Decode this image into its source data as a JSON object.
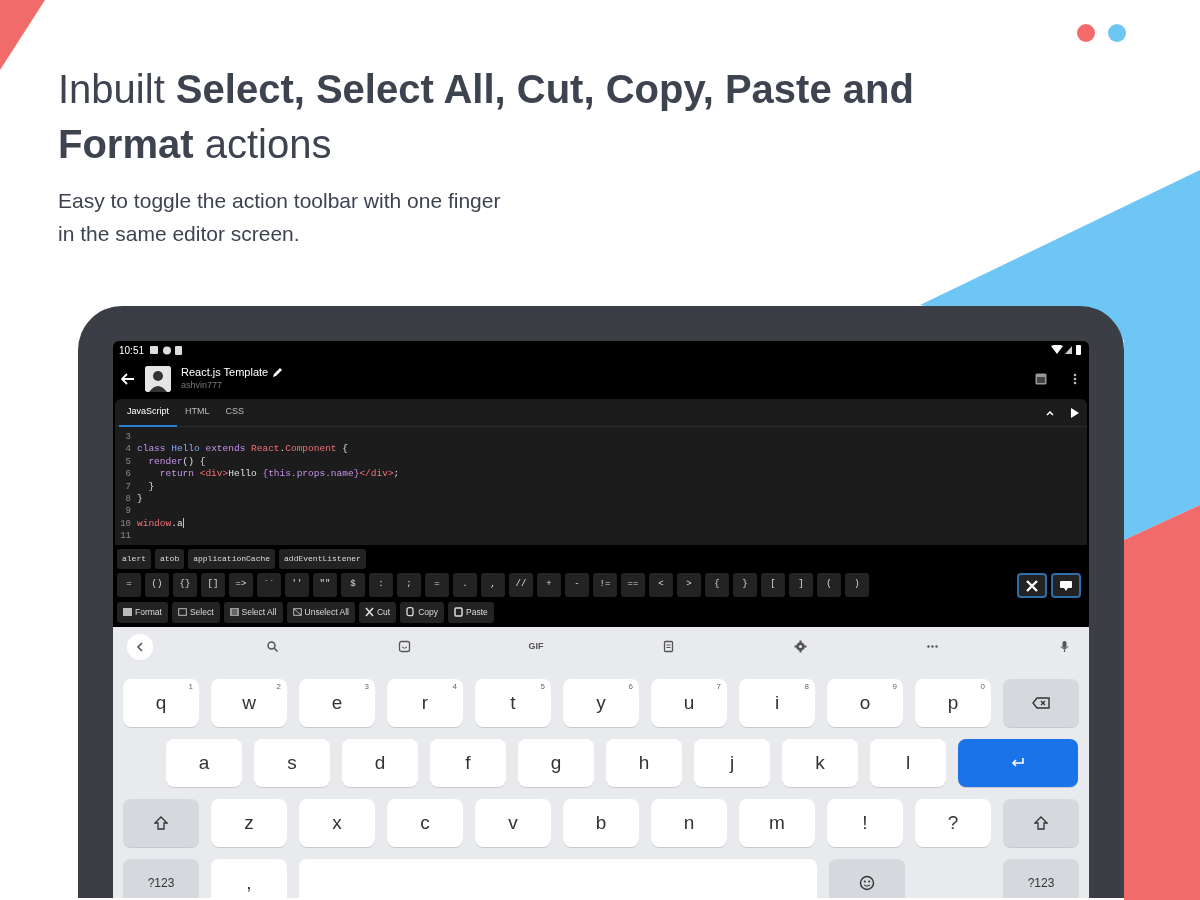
{
  "headline": "Inbuilt **Select, Select All, Cut, Copy, Paste and Format** actions",
  "subtitle": "Easy to toggle the action toolbar with one finger in the same editor screen.",
  "status_bar": {
    "time": "10:51"
  },
  "app_bar": {
    "title": "React.js Template",
    "subtitle": "ashvin777"
  },
  "tabs": [
    {
      "label": "JavaScript",
      "selected": true
    },
    {
      "label": "HTML",
      "selected": false
    },
    {
      "label": "CSS",
      "selected": false
    }
  ],
  "code_lines": [
    {
      "number": "3"
    },
    {
      "number": "4",
      "tokens": [
        {
          "text": "class ",
          "kind": "keyword"
        },
        {
          "text": "Hello ",
          "kind": "name"
        },
        {
          "text": "extends ",
          "kind": "keyword"
        },
        {
          "text": "React",
          "kind": "object"
        },
        {
          "text": ".",
          "kind": "plain"
        },
        {
          "text": "Component ",
          "kind": "object"
        },
        {
          "text": "{",
          "kind": "plain"
        }
      ]
    },
    {
      "number": "5",
      "tokens": [
        {
          "text": "  render",
          "kind": "keyword"
        },
        {
          "text": "() {",
          "kind": "plain"
        }
      ]
    },
    {
      "number": "6",
      "tokens": [
        {
          "text": "    return ",
          "kind": "keyword"
        },
        {
          "text": "<div>",
          "kind": "object"
        },
        {
          "text": "Hello ",
          "kind": "plain"
        },
        {
          "text": "{this.props.name}",
          "kind": "keyword"
        },
        {
          "text": "</div>",
          "kind": "object"
        },
        {
          "text": ";",
          "kind": "plain"
        }
      ]
    },
    {
      "number": "7",
      "tokens": [
        {
          "text": "  }",
          "kind": "plain"
        }
      ]
    },
    {
      "number": "8",
      "tokens": [
        {
          "text": "}",
          "kind": "plain"
        }
      ]
    },
    {
      "number": "9"
    },
    {
      "number": "10",
      "tokens": [
        {
          "text": "window",
          "kind": "object"
        },
        {
          "text": ".a",
          "kind": "plain"
        }
      ],
      "cursor": true
    },
    {
      "number": "11"
    }
  ],
  "suggestions": [
    "alert",
    "atob",
    "applicationCache",
    "addEventListener"
  ],
  "symbols": [
    "=",
    "()",
    "{}",
    "[]",
    "=>",
    "``",
    "''",
    "\"\"",
    "$",
    ":",
    ";",
    "=",
    ".",
    ",",
    "//",
    "+",
    "-",
    "!=",
    "==",
    "<",
    ">",
    "{",
    "}",
    "[",
    "]",
    "(",
    ")"
  ],
  "actions": [
    {
      "label": "Format",
      "kind": "format"
    },
    {
      "label": "Select",
      "kind": "select"
    },
    {
      "label": "Select All",
      "kind": "select_all"
    },
    {
      "label": "Unselect All",
      "kind": "unselect_all"
    },
    {
      "label": "Cut",
      "kind": "cut"
    },
    {
      "label": "Copy",
      "kind": "copy"
    },
    {
      "label": "Paste",
      "kind": "paste"
    }
  ],
  "toggles": [
    {
      "kind": "tools",
      "on": true
    },
    {
      "kind": "keyboard",
      "on": true
    }
  ],
  "keyboard_toolbar": [
    {
      "kind": "back"
    },
    {
      "kind": "search"
    },
    {
      "kind": "sticker"
    },
    {
      "kind": "gif",
      "label": "GIF"
    },
    {
      "kind": "clipboard"
    },
    {
      "kind": "settings"
    },
    {
      "kind": "more"
    },
    {
      "kind": "mic"
    }
  ],
  "keyboard_rows": [
    [
      {
        "kind": "letter",
        "label": "q",
        "hint": "1"
      },
      {
        "kind": "letter",
        "label": "w",
        "hint": "2"
      },
      {
        "kind": "letter",
        "label": "e",
        "hint": "3"
      },
      {
        "kind": "letter",
        "label": "r",
        "hint": "4"
      },
      {
        "kind": "letter",
        "label": "t",
        "hint": "5"
      },
      {
        "kind": "letter",
        "label": "y",
        "hint": "6"
      },
      {
        "kind": "letter",
        "label": "u",
        "hint": "7"
      },
      {
        "kind": "letter",
        "label": "i",
        "hint": "8"
      },
      {
        "kind": "letter",
        "label": "o",
        "hint": "9"
      },
      {
        "kind": "letter",
        "label": "p",
        "hint": "0"
      },
      {
        "kind": "backspace"
      }
    ],
    [
      {
        "kind": "letter",
        "label": "a"
      },
      {
        "kind": "letter",
        "label": "s"
      },
      {
        "kind": "letter",
        "label": "d"
      },
      {
        "kind": "letter",
        "label": "f"
      },
      {
        "kind": "letter",
        "label": "g"
      },
      {
        "kind": "letter",
        "label": "h"
      },
      {
        "kind": "letter",
        "label": "j"
      },
      {
        "kind": "letter",
        "label": "k"
      },
      {
        "kind": "letter",
        "label": "l"
      },
      {
        "kind": "enter"
      }
    ],
    [
      {
        "kind": "shift"
      },
      {
        "kind": "letter",
        "label": "z"
      },
      {
        "kind": "letter",
        "label": "x"
      },
      {
        "kind": "letter",
        "label": "c"
      },
      {
        "kind": "letter",
        "label": "v"
      },
      {
        "kind": "letter",
        "label": "b"
      },
      {
        "kind": "letter",
        "label": "n"
      },
      {
        "kind": "letter",
        "label": "m"
      },
      {
        "kind": "letter",
        "label": "!"
      },
      {
        "kind": "letter",
        "label": "?"
      },
      {
        "kind": "shift"
      }
    ],
    [
      {
        "kind": "mode",
        "label": "?123"
      },
      {
        "kind": "letter",
        "label": ","
      },
      {
        "kind": "space"
      },
      {
        "kind": "emoji"
      },
      {
        "kind": "mode",
        "label": "?123"
      }
    ]
  ]
}
